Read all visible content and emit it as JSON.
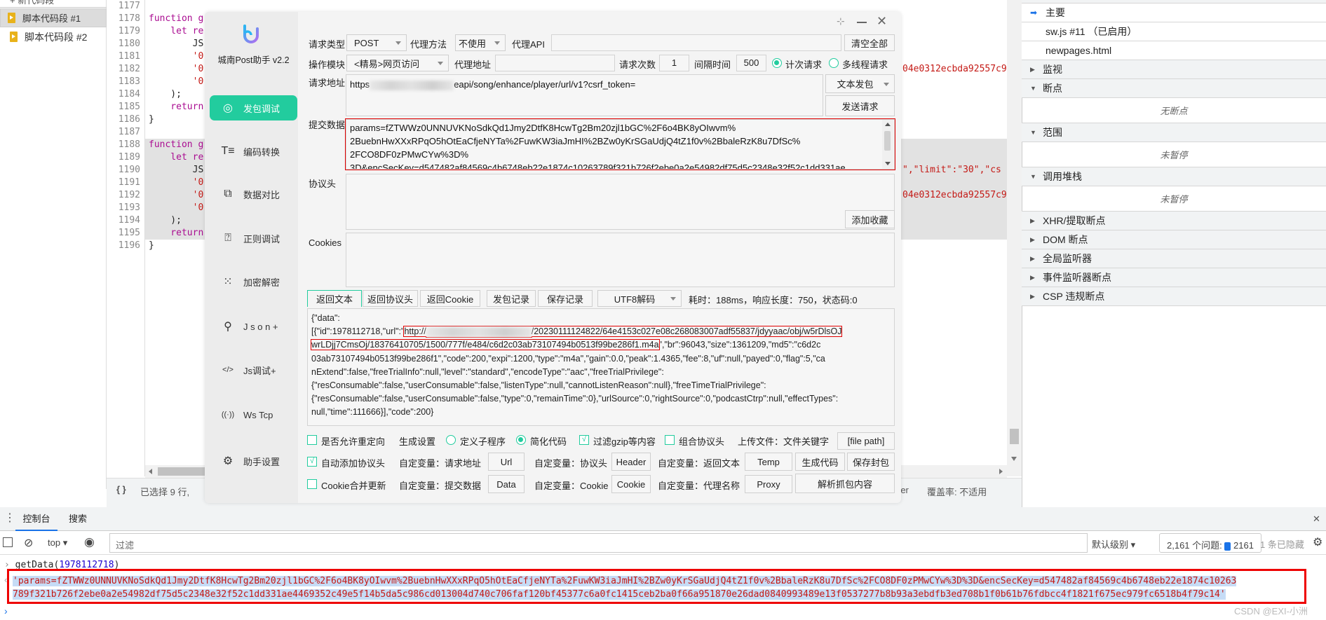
{
  "snippets": {
    "new_label": "+ 新代码段",
    "items": [
      {
        "label": "脚本代码段 #1",
        "selected": true
      },
      {
        "label": "脚本代码段 #2",
        "selected": false
      }
    ]
  },
  "editor": {
    "line_numbers": [
      "1177",
      "1178",
      "1179",
      "1180",
      "1181",
      "1182",
      "1183",
      "1184",
      "1185",
      "1186",
      "1187",
      "1188",
      "1189",
      "1190",
      "1191",
      "1192",
      "1193",
      "1194",
      "1195",
      "1196"
    ],
    "left_fragments": [
      {
        "line": 1,
        "text": "function g",
        "cls": "kw"
      },
      {
        "line": 2,
        "text": "    let re",
        "cls": "kw"
      },
      {
        "line": 3,
        "text": "        JS",
        "cls": ""
      },
      {
        "line": 4,
        "text": "        '0",
        "cls": "str"
      },
      {
        "line": 5,
        "text": "        '0",
        "cls": "str"
      },
      {
        "line": 6,
        "text": "        '0",
        "cls": "str"
      },
      {
        "line": 7,
        "text": "    );",
        "cls": ""
      },
      {
        "line": 8,
        "text": "    return",
        "cls": "kw"
      },
      {
        "line": 9,
        "text": "}",
        "cls": ""
      },
      {
        "line": 11,
        "text": "function g",
        "cls": "kw"
      },
      {
        "line": 12,
        "text": "    let re",
        "cls": "kw"
      },
      {
        "line": 13,
        "text": "        JS",
        "cls": ""
      },
      {
        "line": 14,
        "text": "        '0",
        "cls": "str"
      },
      {
        "line": 15,
        "text": "        '0",
        "cls": "str"
      },
      {
        "line": 16,
        "text": "        '0",
        "cls": "str"
      },
      {
        "line": 17,
        "text": "    );",
        "cls": ""
      },
      {
        "line": 18,
        "text": "    return",
        "cls": "kw"
      },
      {
        "line": 19,
        "text": "}",
        "cls": ""
      }
    ],
    "right_fragments": [
      {
        "line": 5,
        "text": "04e0312ecbda92557c9",
        "cls": "str"
      },
      {
        "line": 13,
        "text": "\",\"limit\":\"30\",\"cs",
        "cls": "str"
      },
      {
        "line": 15,
        "text": "04e0312ecbda92557c9",
        "cls": "str"
      }
    ],
    "status_left": "已选择 9 行, ",
    "status_right_shortcut": "Ctrl+Enter",
    "status_right": "覆盖率: 不适用"
  },
  "right_panel": {
    "threads": [
      {
        "label": "主要",
        "active": true
      },
      {
        "label": "sw.js #11 （已启用）"
      },
      {
        "label": "newpages.html"
      }
    ],
    "sections": [
      {
        "label": "监视",
        "expanded": false
      },
      {
        "label": "断点",
        "expanded": true,
        "empty": "无断点"
      },
      {
        "label": "范围",
        "expanded": true,
        "empty": "未暂停"
      },
      {
        "label": "调用堆栈",
        "expanded": true,
        "empty": "未暂停"
      },
      {
        "label": "XHR/提取断点",
        "expanded": false
      },
      {
        "label": "DOM 断点",
        "expanded": false
      },
      {
        "label": "全局监听器",
        "expanded": false
      },
      {
        "label": "事件监听器断点",
        "expanded": false
      },
      {
        "label": "CSP 违规断点",
        "expanded": false
      }
    ]
  },
  "app": {
    "title": "城南Post助手 v2.2",
    "accent": "#22cc9e",
    "nav": [
      {
        "label": "发包调试",
        "icon": "globe-icon",
        "active": true
      },
      {
        "label": "编码转换",
        "icon": "text-format-icon"
      },
      {
        "label": "数据对比",
        "icon": "compare-icon"
      },
      {
        "label": "正则调试",
        "icon": "regex-help-icon"
      },
      {
        "label": "加密解密",
        "icon": "crypto-icon"
      },
      {
        "label": "J s o n +",
        "icon": "json-tree-icon"
      },
      {
        "label": "Js调试+",
        "icon": "code-icon"
      },
      {
        "label": "Ws Tcp",
        "icon": "broadcast-icon"
      },
      {
        "label": "助手设置",
        "icon": "gear-icon"
      }
    ],
    "form": {
      "request_type_label": "请求类型",
      "request_type": "POST",
      "proxy_method_label": "代理方法",
      "proxy_method": "不使用",
      "proxy_api_label": "代理API",
      "proxy_api": "",
      "clear_all": "清空全部",
      "module_label": "操作模块",
      "module": "<精易>网页访问",
      "proxy_addr_label": "代理地址",
      "proxy_addr": "",
      "count_label": "请求次数",
      "count": "1",
      "interval_label": "间隔时间",
      "interval": "500",
      "mode_count": "计次请求",
      "mode_thread": "多线程请求",
      "url_label": "请求地址",
      "url_prefix": "https",
      "url_suffix": "eapi/song/enhance/player/url/v1?csrf_token=",
      "send_mode": "文本发包",
      "send": "发送请求",
      "body_label": "提交数据",
      "body_lines": [
        "params=fZTWWz0UNNUVKNoSdkQd1Jmy2DtfK8HcwTg2Bm20zjl1bGC%2F6o4BK8yOIwvm%",
        "2BuebnHwXXxRPqO5hOtEaCfjeNYTa%2FuwKW3iaJmHI%2BZw0yKrSGaUdjQ4tZ1f0v%2BbaleRzK8u7DfSc%",
        "2FCO8DF0zPMwCYw%3D%",
        "3D&encSecKey=d547482af84569c4b6748eb22e1874c10263789f321b726f2ebe0a2e54982df75d5c2348e32f52c1dd331ae"
      ],
      "headers_label": "协议头",
      "add_fav": "添加收藏",
      "cookies_label": "Cookies"
    },
    "tabs": [
      "返回文本",
      "返回协议头",
      "返回Cookie",
      "发包记录",
      "保存记录"
    ],
    "decode": "UTF8解码",
    "stats": "耗时：188ms，响应长度：750，状态码:0",
    "response": {
      "line1": "{\"data\":",
      "line2_a": "[{\"id\":1978112718,\"url\":\"",
      "line2_b": "http://",
      "line2_c": "/20230111124822/64e4153c027e08c268083007adf55837/jdyyaac/obj/w5rDlsOJ",
      "line3_a": "wrLDjj7CmsOj/18376410705/1500/777f/e484/c6d2c03ab73107494b0513f99be286f1.m4a",
      "line3_b": "\",\"br\":96043,\"size\":1361209,\"md5\":\"c6d2c",
      "rest": [
        "03ab73107494b0513f99be286f1\",\"code\":200,\"expi\":1200,\"type\":\"m4a\",\"gain\":0.0,\"peak\":1.4365,\"fee\":8,\"uf\":null,\"payed\":0,\"flag\":5,\"ca",
        "nExtend\":false,\"freeTrialInfo\":null,\"level\":\"standard\",\"encodeType\":\"aac\",\"freeTrialPrivilege\":",
        "{\"resConsumable\":false,\"userConsumable\":false,\"listenType\":null,\"cannotListenReason\":null},\"freeTimeTrialPrivilege\":",
        "{\"resConsumable\":false,\"userConsumable\":false,\"type\":0,\"remainTime\":0},\"urlSource\":0,\"rightSource\":0,\"podcastCtrp\":null,\"effectTypes\":",
        "null,\"time\":111666}],\"code\":200}"
      ]
    },
    "options": {
      "redirect": "是否允许重定向",
      "gen_settings": "生成设置",
      "subroutine": "定义子程序",
      "simplify": "简化代码",
      "gzip": "过滤gzip等内容",
      "combine_headers": "组合协议头",
      "upload": "上传文件：文件关键字",
      "file_path": "[file path]",
      "auto_headers": "自动添加协议头",
      "var_url": "自定变量：请求地址",
      "url_btn": "Url",
      "var_headers": "自定变量：协议头",
      "header_btn": "Header",
      "var_resp": "自定变量：返回文本",
      "temp_btn": "Temp",
      "gen_code": "生成代码",
      "save_packet": "保存封包",
      "cookie_merge": "Cookie合并更新",
      "var_data": "自定变量：提交数据",
      "data_btn": "Data",
      "var_cookie": "自定变量：Cookie",
      "cookie_btn": "Cookie",
      "var_proxy": "自定变量：代理名称",
      "proxy_btn": "Proxy",
      "parse_capture": "解析抓包内容"
    }
  },
  "console": {
    "tabs": [
      "控制台",
      "搜索"
    ],
    "context": "top",
    "filter_placeholder": "过滤",
    "level": "默认级别",
    "issues_label": "2,161 个问题:",
    "issues_count": "2161",
    "hidden": "1 条已隐藏",
    "input_fn": "getData(",
    "input_arg": "1978112718",
    "input_close": ")",
    "output_line1": "'params=fZTWWz0UNNUVKNoSdkQd1Jmy2DtfK8HcwTg2Bm20zjl1bGC%2F6o4BK8yOIwvm%2BuebnHwXXxRPqO5hOtEaCfjeNYTa%2FuwKW3iaJmHI%2BZw0yKrSGaUdjQ4tZ1f0v%2BbaleRzK8u7DfSc%2FCO8DF0zPMwCYw%3D%3D&encSecKey=d547482af84569c4b6748eb22e1874c10263",
    "output_line2": "789f321b726f2ebe0a2e54982df75d5c2348e32f52c1dd331ae4469352c49e5f14b5da5c986cd013004d740c706faf120bf45377c6a0fc1415ceb2ba0f66a951870e26dad0840993489e13f0537277b8b93a3ebdfb3ed708b1f0b61b76fdbcc4f1821f675ec979fc6518b4f79c14'"
  },
  "watermark": "CSDN @EXI-小洲"
}
